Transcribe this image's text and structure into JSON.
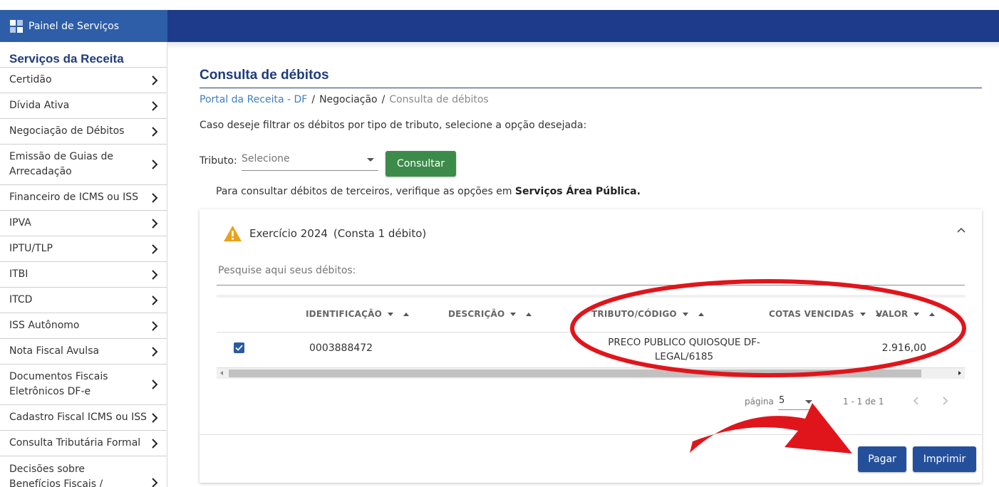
{
  "brand": {
    "title": "Painel de Serviços"
  },
  "sidebar": {
    "title": "Serviços da Receita",
    "items": [
      {
        "label": "Certidão"
      },
      {
        "label": "Dívida Ativa"
      },
      {
        "label": "Negociação de Débitos"
      },
      {
        "label": "Emissão de Guias de Arrecadação"
      },
      {
        "label": "Financeiro de ICMS ou ISS"
      },
      {
        "label": "IPVA"
      },
      {
        "label": "IPTU/TLP"
      },
      {
        "label": "ITBI"
      },
      {
        "label": "ITCD"
      },
      {
        "label": "ISS Autônomo"
      },
      {
        "label": "Nota Fiscal Avulsa"
      },
      {
        "label": "Documentos Fiscais Eletrônicos DF-e"
      },
      {
        "label": "Cadastro Fiscal ICMS ou ISS"
      },
      {
        "label": "Consulta Tributária Formal"
      },
      {
        "label": "Decisões sobre Benefícios Fiscais / Restituições /"
      }
    ]
  },
  "main": {
    "title": "Consulta de débitos",
    "breadcrumb": {
      "link": "Portal da Receita - DF",
      "sep": "/",
      "middle": "Negociação",
      "current": "Consulta de débitos"
    },
    "instruction": "Caso deseje filtrar os débitos por tipo de tributo, selecione a opção desejada:",
    "tributo_label": "Tributo:",
    "tributo_value": "Selecione",
    "consultar_label": "Consultar",
    "terceiros_text": "Para consultar débitos de terceiros, verifique as opções em ",
    "terceiros_bold": "Serviços Área Pública."
  },
  "card": {
    "exercise_title": "Exercício 2024",
    "exercise_count": "(Consta 1 débito)",
    "search_placeholder": "Pesquise aqui seus débitos:",
    "columns": [
      "IDENTIFICAÇÃO",
      "DESCRIÇÃO",
      "TRIBUTO/CÓDIGO",
      "COTAS VENCIDAS",
      "VALOR"
    ],
    "rows": [
      {
        "checked": true,
        "identificacao": "0003888472",
        "descricao": "",
        "tributo_line1": "PRECO PUBLICO QUIOSQUE DF-",
        "tributo_line2": "LEGAL/6185",
        "cotas": "",
        "valor": "2.916,00"
      }
    ],
    "pager": {
      "label": "página",
      "page_size": "5",
      "range": "1 - 1 de 1"
    },
    "pagar_label": "Pagar",
    "imprimir_label": "Imprimir"
  },
  "colors": {
    "topbar": "#1e3a8a",
    "brand": "#2e5ea8",
    "consultar": "#3d8b4a",
    "primary_button": "#24509b",
    "annotation": "#e0151b"
  }
}
